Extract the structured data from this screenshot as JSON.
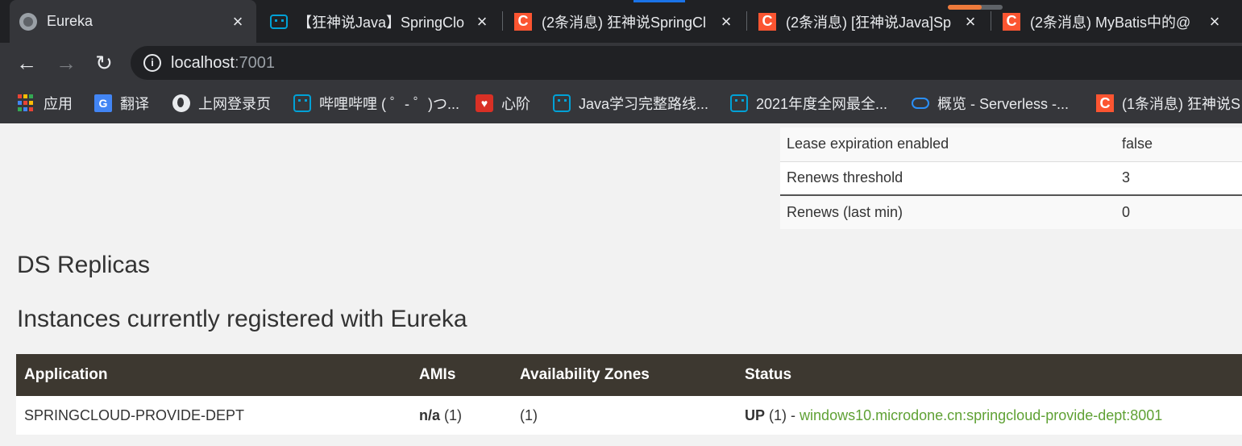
{
  "browser": {
    "tabs": [
      {
        "title": "Eureka",
        "icon": "globe-icon",
        "active": true
      },
      {
        "title": "【狂神说Java】SpringClo",
        "icon": "bilibili-icon"
      },
      {
        "title": "(2条消息) 狂神说SpringCl",
        "icon": "csdn-icon"
      },
      {
        "title": "(2条消息) [狂神说Java]Sp",
        "icon": "csdn-icon"
      },
      {
        "title": "(2条消息) MyBatis中的@",
        "icon": "csdn-icon"
      }
    ],
    "tab_close": "×",
    "csdn_glyph": "C",
    "url_host": "localhost",
    "url_port": ":7001",
    "info_glyph": "i",
    "nav": {
      "back": "←",
      "forward": "→",
      "reload": "↻"
    }
  },
  "bookmarks": [
    {
      "label": "应用",
      "icon": "apps-icon"
    },
    {
      "label": "翻译",
      "icon": "translate-icon",
      "glyph": "G"
    },
    {
      "label": "上网登录页",
      "icon": "globe-icon"
    },
    {
      "label": "哔哩哔哩 ( ゜- ゜)つ...",
      "icon": "bilibili-icon"
    },
    {
      "label": "心阶",
      "icon": "heart-icon",
      "glyph": "♥"
    },
    {
      "label": "Java学习完整路线...",
      "icon": "bilibili-icon"
    },
    {
      "label": "2021年度全网最全...",
      "icon": "bilibili-icon"
    },
    {
      "label": "概览 - Serverless -...",
      "icon": "cloud-icon"
    },
    {
      "label": "(1条消息) 狂神说S",
      "icon": "csdn-icon",
      "glyph": "C"
    }
  ],
  "lease": [
    {
      "label": "Lease expiration enabled",
      "value": "false"
    },
    {
      "label": "Renews threshold",
      "value": "3"
    },
    {
      "label": "Renews (last min)",
      "value": "0"
    }
  ],
  "sections": {
    "replicas": "DS Replicas",
    "instances": "Instances currently registered with Eureka"
  },
  "instances": {
    "headers": [
      "Application",
      "AMIs",
      "Availability Zones",
      "Status"
    ],
    "rows": [
      {
        "application": "SPRINGCLOUD-PROVIDE-DEPT",
        "ami": "n/a",
        "ami_count": "(1)",
        "zones": "(1)",
        "status": "UP",
        "status_count": "(1) -",
        "instance_link": "windows10.microdone.cn:springcloud-provide-dept:8001"
      }
    ]
  },
  "colors": {
    "header_bg": "#3d3830",
    "link": "#5fa134",
    "csdn": "#fc5531",
    "bilibili": "#00a1d6"
  }
}
